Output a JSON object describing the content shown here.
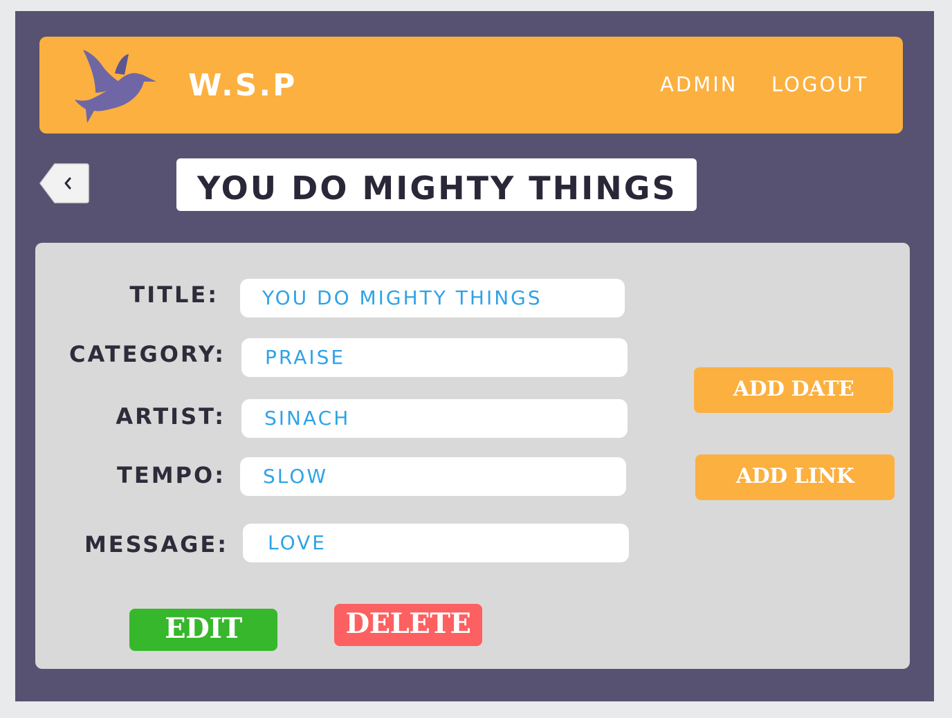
{
  "header": {
    "brand": "W.S.P",
    "nav": {
      "admin": "ADMIN",
      "logout": "LOGOUT"
    }
  },
  "page": {
    "title": "YOU DO MIGHTY THINGS"
  },
  "form": {
    "title_label": "TITLE:",
    "title_value": "YOU DO MIGHTY THINGS",
    "category_label": "CATEGORY:",
    "category_value": "PRAISE",
    "artist_label": "ARTIST:",
    "artist_value": "SINACH",
    "tempo_label": "TEMPO:",
    "tempo_value": "SLOW",
    "message_label": "MESSAGE:",
    "message_value": "LOVE"
  },
  "actions": {
    "add_date": "ADD DATE",
    "add_link": "ADD LINK",
    "edit": "EDIT",
    "delete": "DELETE"
  },
  "icons": {
    "logo": "dove-icon",
    "back": "chevron-left-icon"
  },
  "colors": {
    "frame": "#575271",
    "accent": "#fcb040",
    "panel": "#d9d9d9",
    "input_text": "#2ea3e6",
    "edit": "#37b72c",
    "delete": "#fd6060",
    "logo": "#6f66a6"
  }
}
